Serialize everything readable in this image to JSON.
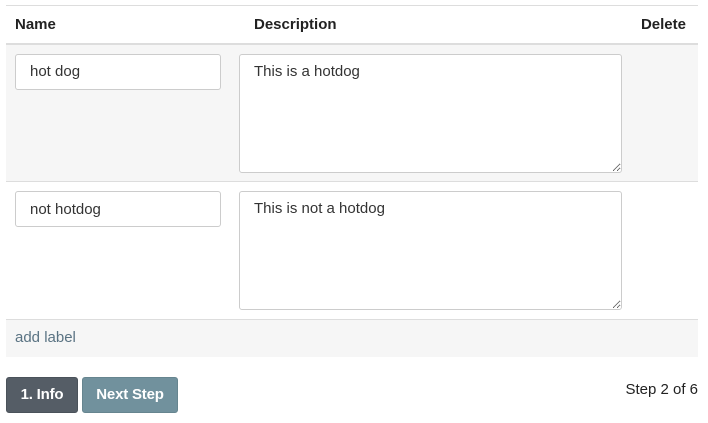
{
  "table": {
    "headers": {
      "name": "Name",
      "description": "Description",
      "delete": "Delete"
    },
    "rows": [
      {
        "name": "hot dog",
        "description": "This is a hotdog"
      },
      {
        "name": "not hotdog",
        "description": "This is not a hotdog"
      }
    ],
    "add_label": "add label"
  },
  "footer": {
    "info_button": "1. Info",
    "next_button": "Next Step",
    "step_text": "Step 2 of 6"
  },
  "colors": {
    "info_button_bg": "#555d66",
    "next_button_bg": "#71919d",
    "link": "#5a7383",
    "stripe": "#f6f6f6"
  }
}
